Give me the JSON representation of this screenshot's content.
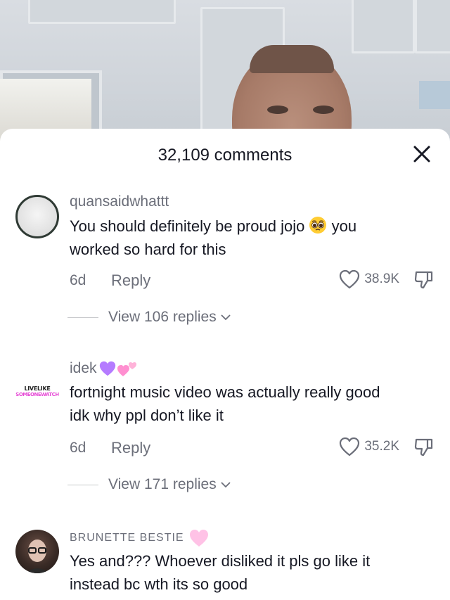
{
  "sheet": {
    "comments_count": "32,109 comments"
  },
  "icons": {
    "close": "close-icon",
    "like": "heart-outline-icon",
    "dislike": "thumbs-down-icon",
    "chevron": "chevron-down-icon"
  },
  "colors": {
    "text_primary": "#161823",
    "text_secondary": "#6b6e79",
    "purple_heart": "#b57bff",
    "pink_heart": "#ffb3d9"
  },
  "comments": [
    {
      "username": "quansaidwhattt",
      "text_line1_a": "You should definitely be proud jojo",
      "text_line1_b": "you",
      "text_line2": "worked so hard for this",
      "time": "6d",
      "reply_label": "Reply",
      "likes": "38.9K",
      "view_replies": "View 106 replies"
    },
    {
      "username": "idek",
      "avatar_text_1": "LIVELIKE",
      "avatar_text_2": "SOMEONEWATCH",
      "text_line1": "fortnight music video was actually really good",
      "text_line2": "idk why ppl don’t like it",
      "time": "6d",
      "reply_label": "Reply",
      "likes": "35.2K",
      "view_replies": "View 171 replies"
    },
    {
      "username": "BRUNETTE BESTIE",
      "text_line1": "Yes and??? Whoever disliked it pls go like it",
      "text_line2": "instead bc wth its so good"
    }
  ]
}
